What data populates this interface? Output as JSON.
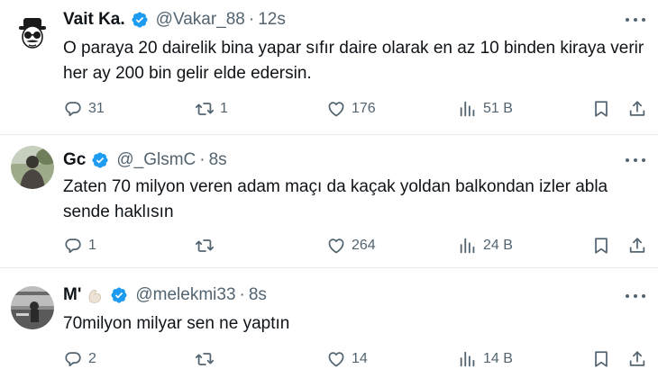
{
  "tweets": [
    {
      "name": "Vait Ka.",
      "handle": "@Vakar_88",
      "dot": "·",
      "time": "12s",
      "text_lines": [
        "O paraya 20 dairelik bina yapar sıfır daire olarak en az 10 binden kiraya verir",
        "her ay 200 bin gelir elde edersin."
      ],
      "replies": "31",
      "retweets": "1",
      "likes": "176",
      "views": "51 B"
    },
    {
      "name": "Gc",
      "handle": "@_GlsmC",
      "dot": "·",
      "time": "8s",
      "text_lines": [
        "Zaten 70 milyon veren adam maçı da kaçak yoldan balkondan izler abla",
        "sende haklısın"
      ],
      "replies": "1",
      "retweets": "",
      "likes": "264",
      "views": "24 B"
    },
    {
      "name": "M'",
      "handle": "@melekmi33",
      "dot": "·",
      "time": "8s",
      "text_lines": [
        "70milyon milyar sen ne yaptın"
      ],
      "replies": "2",
      "retweets": "",
      "likes": "14",
      "views": "14 B"
    }
  ],
  "icons": {
    "verified": "verified-badge-icon",
    "more": "more-options-icon",
    "reply": "reply-icon",
    "retweet": "retweet-icon",
    "like": "heart-icon",
    "views": "views-chart-icon",
    "bookmark": "bookmark-icon",
    "share": "share-icon"
  },
  "colors": {
    "verified": "#1d9bf0",
    "muted": "#536471",
    "text": "#0f1419",
    "divider": "#e6ecf0"
  }
}
